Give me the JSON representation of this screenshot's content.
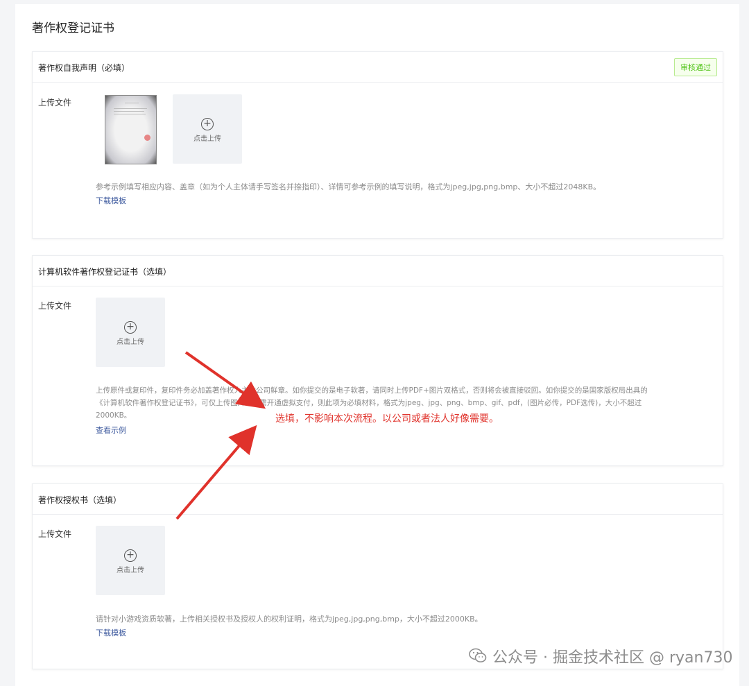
{
  "page": {
    "title": "著作权登记证书"
  },
  "sections": [
    {
      "title": "著作权自我声明（必填）",
      "status_badge": "审核通过",
      "field_label": "上传文件",
      "upload_label": "点击上传",
      "hint": "参考示例填写相应内容、盖章（如为个人主体请手写签名并捺指印）、详情可参考示例的填写说明，格式为jpeg,jpg,png,bmp、大小不超过2048KB。",
      "link": "下载模板"
    },
    {
      "title": "计算机软件著作权登记证书（选填）",
      "field_label": "上传文件",
      "upload_label": "点击上传",
      "hint_lines": [
        "上传原件或复印件，复印件务必加盖著作权人主体公司鲜章。如你提交的是电子软著，请同时上传PDF+图片双格式，否则将会被直接驳回。如你提交的是国家版权局出具的",
        "《计算机软件著作权登记证书》，可仅上传图片。如需开通虚拟支付，则此项为必填材料，格式为jpeg、jpg、png、bmp、gif、pdf，(图片必传，PDF选传)，大小不超过",
        "2000KB。"
      ],
      "link": "查看示例"
    },
    {
      "title": "著作权授权书（选填）",
      "field_label": "上传文件",
      "upload_label": "点击上传",
      "hint": "请针对小游戏资质软著，上传相关授权书及授权人的权利证明，格式为jpeg,jpg,png,bmp，大小不超过2000KB。",
      "link": "下载模板"
    }
  ],
  "annotation": {
    "text": "选填，不影响本次流程。以公司或者法人好像需要。",
    "color": "#e0322b"
  },
  "watermark": {
    "text": "公众号 · 掘金技术社区 @ ryan730"
  },
  "colors": {
    "success": "#52c41a",
    "link": "#3e5a9e",
    "upload_bg": "#f0f2f5"
  }
}
